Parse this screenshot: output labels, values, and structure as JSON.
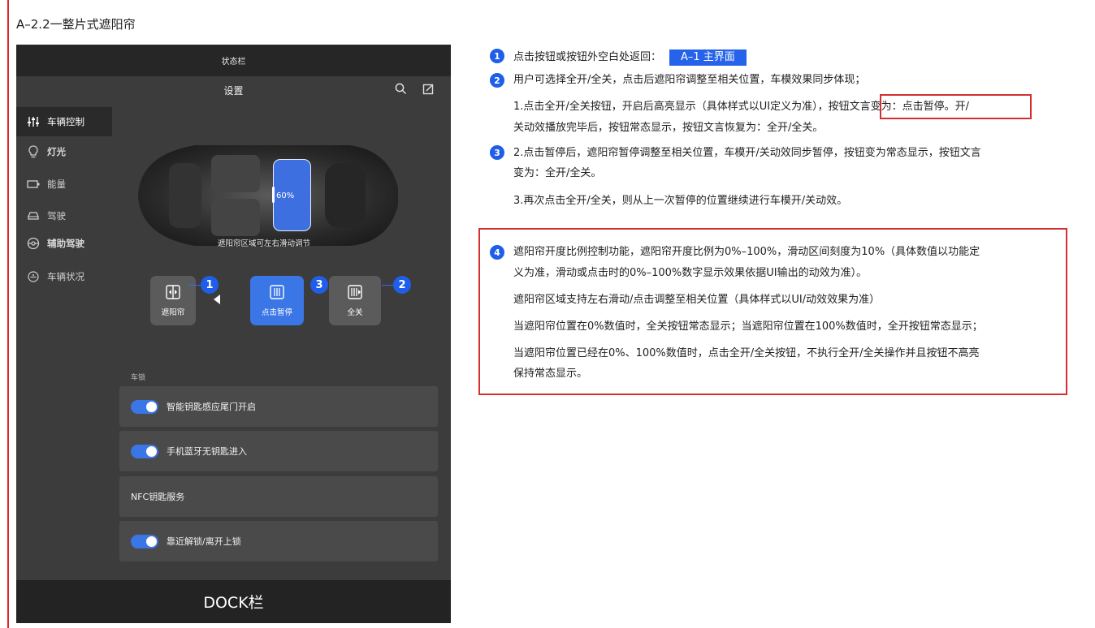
{
  "doc": {
    "heading": "A–2.2一整片式遮阳帘"
  },
  "mock": {
    "statusbar": "状态栏",
    "title": "设置",
    "sidebar": [
      {
        "label": "车辆控制",
        "icon": "sliders-icon"
      },
      {
        "label": "灯光",
        "icon": "bulb-icon"
      },
      {
        "label": "能量",
        "icon": "battery-icon"
      },
      {
        "label": "驾驶",
        "icon": "car-icon"
      },
      {
        "label": "辅助驾驶",
        "icon": "steering-wheel-icon"
      },
      {
        "label": "车辆状况",
        "icon": "car-status-icon"
      }
    ],
    "shade_percent": "60%",
    "car_caption": "遮阳帘区域可左右滑动调节",
    "buttons": {
      "sunshade": "遮阳帘",
      "pause": "点击暂停",
      "close_all": "全关"
    },
    "badges": {
      "b1": "1",
      "b2": "2",
      "b3": "3"
    },
    "lock_section": "车锁",
    "rows": [
      {
        "label": "智能钥匙感应尾门开启",
        "toggle": true
      },
      {
        "label": "手机蓝牙无钥匙进入",
        "toggle": true
      },
      {
        "label": "NFC钥匙服务",
        "toggle": false
      },
      {
        "label": "靠近解锁/离开上锁",
        "toggle": true
      }
    ],
    "dock": "DOCK栏"
  },
  "notes": {
    "n1": {
      "num": "1",
      "text": "点击按钮或按钮外空白处返回：",
      "chip": "A–1 主界面"
    },
    "n2": {
      "num": "2",
      "text": "用户可选择全开/全关，点击后遮阳帘调整至相关位置，车模效果同步体现；",
      "sub1a": "1.点击全开/全关按钮，开启后高亮显示（具体样式以UI定义为准），",
      "sub1b": "按钮文言变为：点击暂停。",
      "sub1c": "开/",
      "sub1d": "关动效播放完毕后，按钮常态显示，按钮文言恢复为：全开/全关。"
    },
    "n3": {
      "num": "3",
      "text": "2.点击暂停后，遮阳帘暂停调整至相关位置，车模开/关动效同步暂停，按钮变为常态显示，按钮文言",
      "text2": "变为：全开/全关。",
      "sub3": "3.再次点击全开/全关，则从上一次暂停的位置继续进行车模开/关动效。"
    },
    "n4": {
      "num": "4",
      "l1": "遮阳帘开度比例控制功能，遮阳帘开度比例为0%–100%，滑动区间刻度为10%（具体数值以功能定",
      "l2": "义为准，滑动或点击时的0%–100%数字显示效果依据UI输出的动效为准）。",
      "l3": "遮阳帘区域支持左右滑动/点击调整至相关位置（具体样式以UI/动效效果为准）",
      "l4": "当遮阳帘位置在0%数值时，全关按钮常态显示；当遮阳帘位置在100%数值时，全开按钮常态显示；",
      "l5": "当遮阳帘位置已经在0%、100%数值时，点击全开/全关按钮，不执行全开/全关操作并且按钮不高亮",
      "l6": "保持常态显示。"
    }
  }
}
